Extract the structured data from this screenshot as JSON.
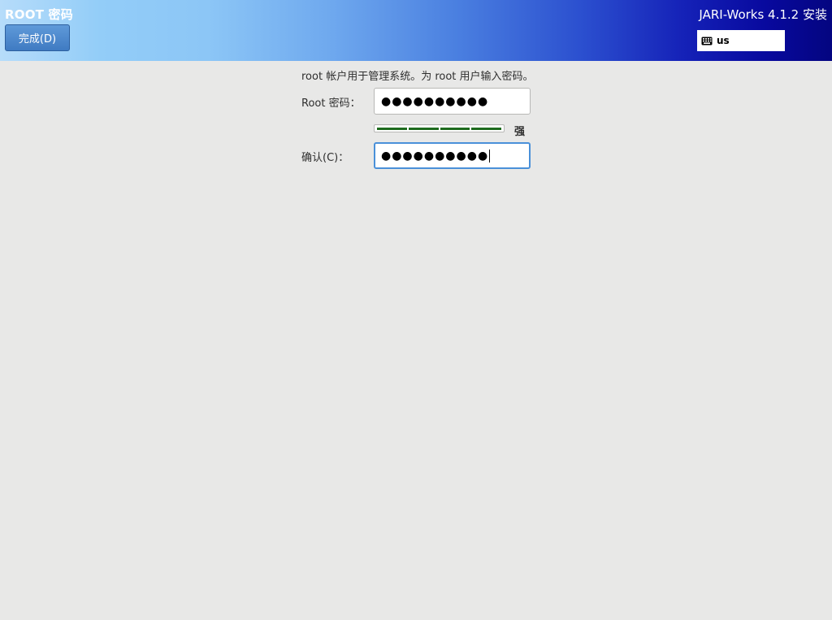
{
  "header": {
    "page_title": "ROOT 密码",
    "done_label": "完成(D)",
    "product_title": "JARI-Works 4.1.2 安装",
    "keyboard_layout": "us",
    "keyboard_icon": "keyboard-icon"
  },
  "form": {
    "description": "root 帐户用于管理系统。为 root 用户输入密码。",
    "root_password_label": "Root 密码：",
    "root_password_value": "●●●●●●●●●●",
    "strength": {
      "level": 1.0,
      "segments": 4,
      "filled_segments": 4,
      "label": "强",
      "color": "#1e6b1e"
    },
    "confirm_label": "确认(C)：",
    "confirm_value": "●●●●●●●●●●",
    "focused_field": "confirm"
  },
  "colors": {
    "background": "#e8e8e7",
    "focus_border": "#4a90d9",
    "header_gradient_start": "#b6dcfa",
    "header_gradient_end": "#040580"
  }
}
